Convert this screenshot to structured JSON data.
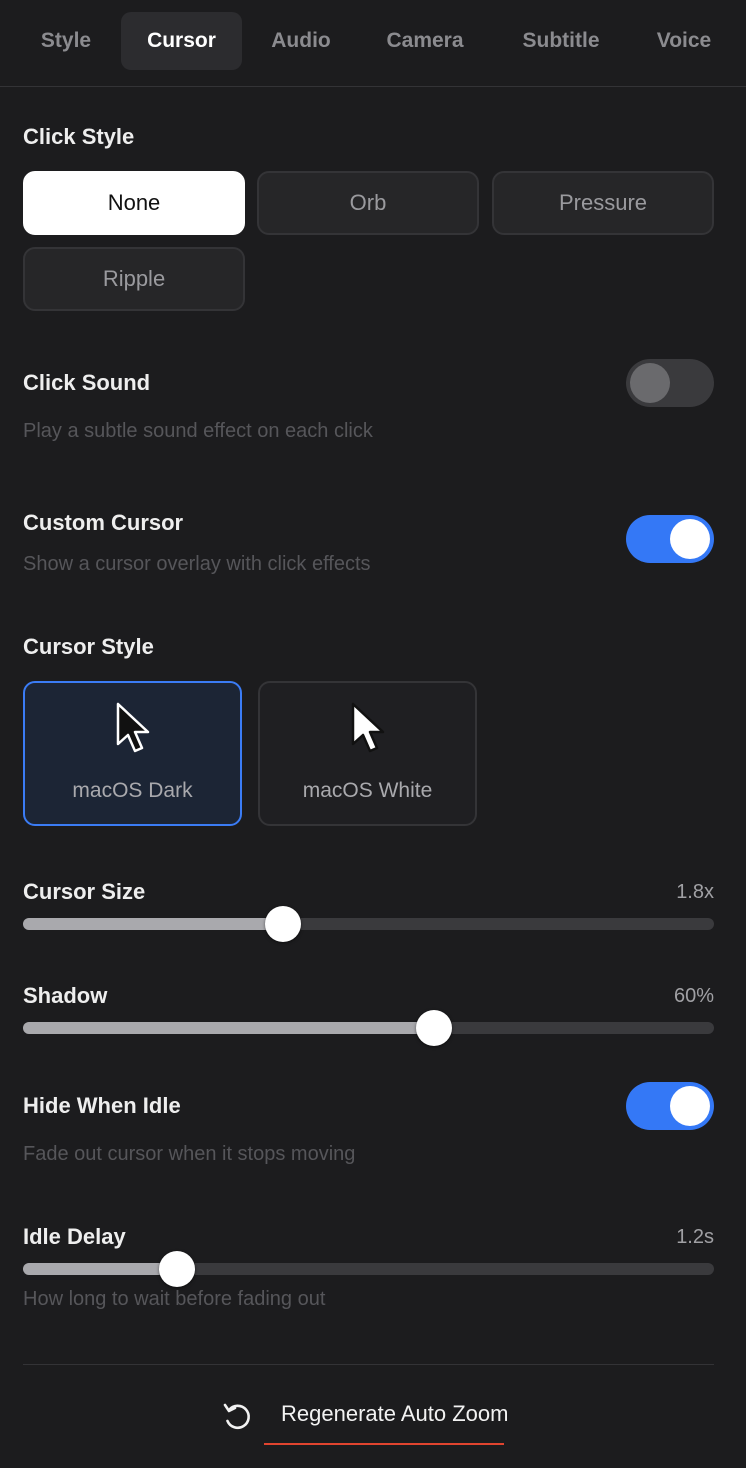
{
  "tabs": [
    {
      "label": "Style"
    },
    {
      "label": "Cursor"
    },
    {
      "label": "Audio"
    },
    {
      "label": "Camera"
    },
    {
      "label": "Subtitle"
    },
    {
      "label": "Voice"
    }
  ],
  "active_tab": "Cursor",
  "click_style": {
    "label": "Click Style",
    "options": [
      "None",
      "Orb",
      "Pressure",
      "Ripple"
    ],
    "selected": "None"
  },
  "click_sound": {
    "label": "Click Sound",
    "description": "Play a subtle sound effect on each click",
    "enabled": false
  },
  "custom_cursor": {
    "label": "Custom Cursor",
    "description": "Show a cursor overlay with click effects",
    "enabled": true
  },
  "cursor_style": {
    "label": "Cursor Style",
    "options": [
      {
        "name": "macOS Dark",
        "icon": "cursor-arrow-black-icon"
      },
      {
        "name": "macOS White",
        "icon": "cursor-arrow-white-icon"
      }
    ],
    "selected": "macOS Dark"
  },
  "cursor_size": {
    "label": "Cursor Size",
    "value_text": "1.8x",
    "fraction": 0.376
  },
  "shadow": {
    "label": "Shadow",
    "value_text": "60%",
    "fraction": 0.595
  },
  "hide_when_idle": {
    "label": "Hide When Idle",
    "description": "Fade out cursor when it stops moving",
    "enabled": true
  },
  "idle_delay": {
    "label": "Idle Delay",
    "value_text": "1.2s",
    "fraction": 0.223,
    "description": "How long to wait before fading out"
  },
  "footer": {
    "button_label": "Regenerate Auto Zoom",
    "icon": "refresh-icon",
    "accent_color": "#e0442f"
  },
  "colors": {
    "toggle_on": "#3478f6",
    "selection_border": "#3b7cf5",
    "background": "#1c1c1e"
  }
}
